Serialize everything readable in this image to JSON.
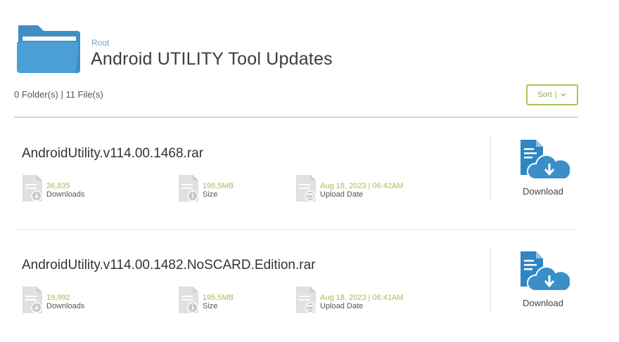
{
  "breadcrumb": "Root",
  "page_title": "Android UTILITY Tool Updates",
  "counts": "0 Folder(s) | 11 File(s)",
  "sort": {
    "label": "Sort",
    "separator": "|"
  },
  "colors": {
    "folder": "#3f8fc4",
    "accent": "#9dc05a",
    "file_icon": "#e0e0e0",
    "download_icon": "#2f86c1"
  },
  "files": [
    {
      "name": "AndroidUtility.v114.00.1468.rar",
      "downloads_value": "36,835",
      "downloads_label": "Downloads",
      "size_value": "195.5MB",
      "size_label": "Size",
      "date_value": "Aug 18, 2023 | 06:42AM",
      "date_label": "Upload Date",
      "download_label": "Download"
    },
    {
      "name": "AndroidUtility.v114.00.1482.NoSCARD.Edition.rar",
      "downloads_value": "19,992",
      "downloads_label": "Downloads",
      "size_value": "195.5MB",
      "size_label": "Size",
      "date_value": "Aug 18, 2023 | 06:41AM",
      "date_label": "Upload Date",
      "download_label": "Download"
    }
  ]
}
